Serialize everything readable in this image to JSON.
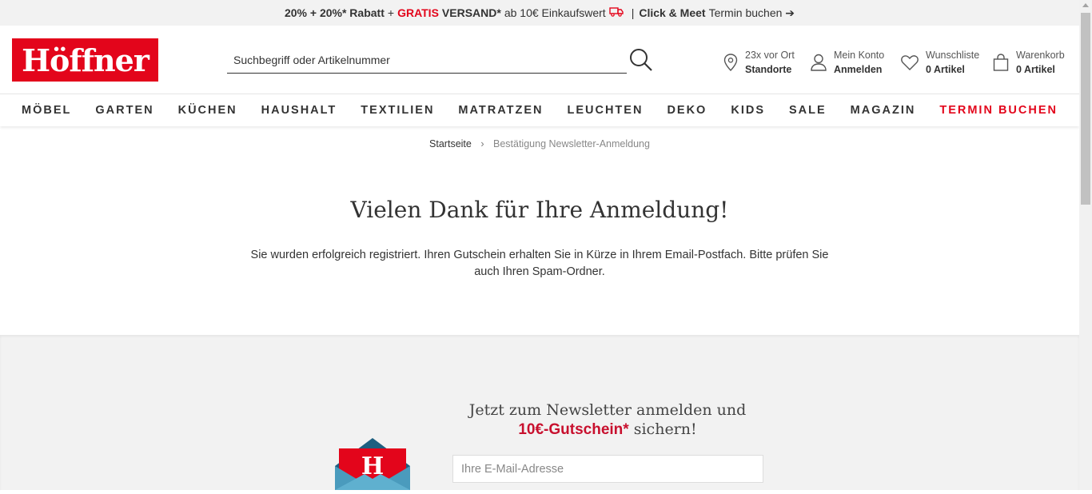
{
  "promo": {
    "part1": "20% + 20%* Rabatt",
    "plus": "+",
    "gratis": "GRATIS",
    "versand": "VERSAND*",
    "rest": "ab 10€ Einkaufswert",
    "pipe": "|",
    "click_meet": "Click & Meet",
    "termin": "Termin buchen ➔"
  },
  "header": {
    "logo_text": "Höffner",
    "search_placeholder": "Suchbegriff oder Artikelnummer",
    "stores": {
      "line1": "23x vor Ort",
      "line2": "Standorte"
    },
    "account": {
      "line1": "Mein Konto",
      "line2": "Anmelden"
    },
    "wishlist": {
      "line1": "Wunschliste",
      "line2": "0 Artikel"
    },
    "cart": {
      "line1": "Warenkorb",
      "line2": "0 Artikel"
    }
  },
  "nav": {
    "items": [
      "MÖBEL",
      "GARTEN",
      "KÜCHEN",
      "HAUSHALT",
      "TEXTILIEN",
      "MATRATZEN",
      "LEUCHTEN",
      "DEKO",
      "KIDS",
      "SALE",
      "MAGAZIN"
    ],
    "highlight": "TERMIN BUCHEN"
  },
  "breadcrumb": {
    "home": "Startseite",
    "current": "Bestätigung Newsletter-Anmeldung"
  },
  "content": {
    "headline": "Vielen Dank für Ihre Anmeldung!",
    "body_line1": "Sie wurden erfolgreich registriert. Ihren Gutschein erhalten Sie in Kürze in Ihrem Email-Postfach. Bitte prüfen Sie",
    "body_line2": "auch Ihren Spam-Ordner."
  },
  "newsletter": {
    "title_line1": "Jetzt zum Newsletter anmelden und",
    "title_highlight": "10€-Gutschein*",
    "title_suffix": "sichern!",
    "email_placeholder": "Ihre E-Mail-Adresse",
    "envelope_letter": "H"
  },
  "colors": {
    "brand_red": "#e3051b",
    "envelope_blue": "#4a9bbd",
    "background_gray": "#f2f2f2"
  }
}
